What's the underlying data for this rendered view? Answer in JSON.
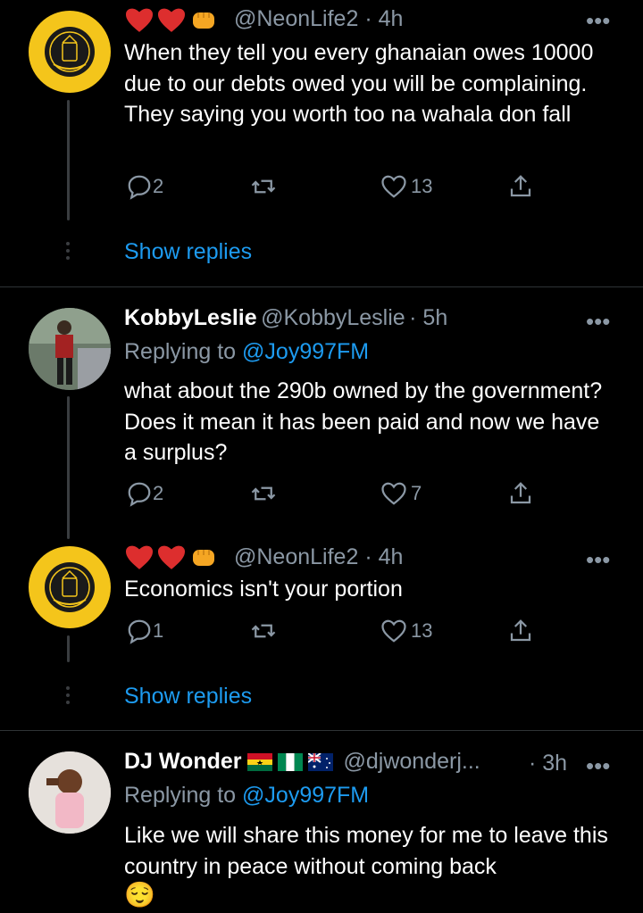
{
  "tweets": [
    {
      "handle": "@NeonLife2",
      "time": "· 4h",
      "text": "When they tell you every ghanaian owes 10000 due to our debts owed you will be complaining. They saying you worth too na wahala don fall",
      "replies": "2",
      "likes": "13"
    },
    {
      "name": "KobbyLeslie",
      "handle": "@KobbyLeslie",
      "time": "· 5h",
      "replying_prefix": "Replying to ",
      "replying_to": "@Joy997FM",
      "text": "what about the 290b owned by the government? Does it mean it has been paid and now we have a surplus?",
      "replies": "2",
      "likes": "7"
    },
    {
      "handle": "@NeonLife2",
      "time": "· 4h",
      "text": "Economics isn't your portion",
      "replies": "1",
      "likes": "13"
    },
    {
      "name": "DJ Wonder",
      "handle": "@djwonderj...",
      "time": "· 3h",
      "replying_prefix": "Replying to ",
      "replying_to": "@Joy997FM",
      "text": "Like we will share this money for me to leave this country in peace without coming back",
      "emoji": "😌"
    }
  ],
  "show_replies_label": "Show replies",
  "more_label": "•••",
  "icons": [
    "heart-emoji-icon",
    "fist-emoji-icon",
    "reply-icon",
    "retweet-icon",
    "like-icon",
    "share-icon",
    "more-icon",
    "ghana-flag-icon",
    "nigeria-flag-icon",
    "australia-flag-icon"
  ],
  "colors": {
    "background": "#000000",
    "accent": "#1d9bf0",
    "muted": "#8b98a5",
    "gold": "#f4c51b"
  }
}
